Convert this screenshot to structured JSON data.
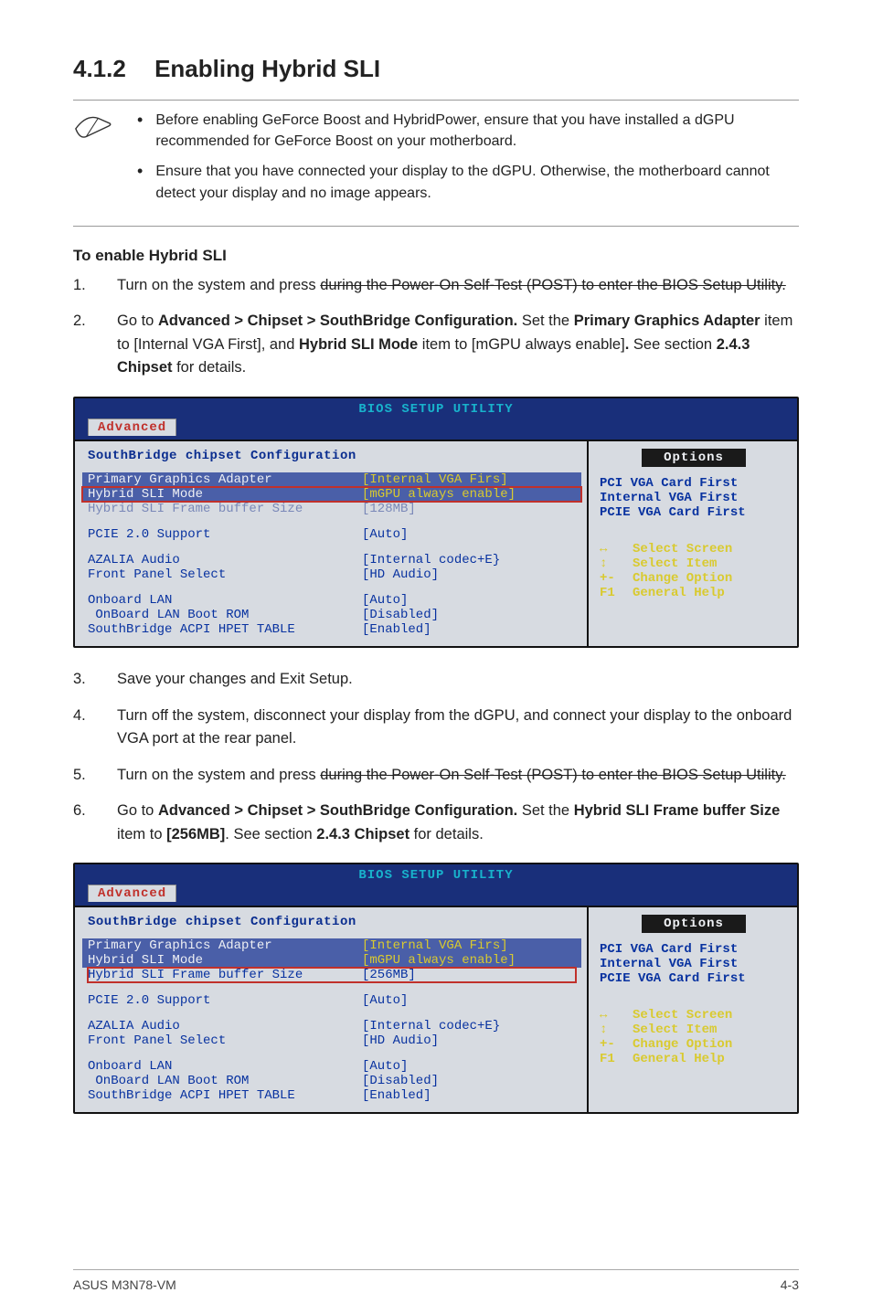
{
  "heading": {
    "number": "4.1.2",
    "title": "Enabling Hybrid SLI"
  },
  "notes": [
    "Before enabling GeForce Boost and HybridPower, ensure that you have installed a dGPU recommended for GeForce Boost on your motherboard.",
    "Ensure that you have connected your display to the dGPU. Otherwise, the motherboard cannot detect your display and no image appears."
  ],
  "enable_heading": "To enable Hybrid SLI",
  "steps_first": [
    {
      "n": "1.",
      "html": "Turn on the system and press <Del> during the Power-On Self-Test (POST) to enter the BIOS Setup Utility."
    },
    {
      "n": "2.",
      "html": "Go to <b>Advanced > Chipset > SouthBridge Configuration.</b> Set the <b>Primary Graphics Adapter</b> item to [Internal VGA First], and <b>Hybrid SLI Mode</b> item to [mGPU always enable]<b>.</b> See section <b>2.4.3 Chipset</b> for details."
    }
  ],
  "steps_second": [
    {
      "n": "3.",
      "html": "Save your changes and Exit Setup."
    },
    {
      "n": "4.",
      "html": "Turn off the system, disconnect your display from the dGPU, and connect your display to the onboard VGA port at the rear panel."
    },
    {
      "n": "5.",
      "html": "Turn on the system and press <Del> during the Power-On Self-Test (POST) to enter the BIOS Setup Utility."
    },
    {
      "n": "6.",
      "html": "Go to <b>Advanced > Chipset > SouthBridge Configuration.</b> Set the <b>Hybrid SLI Frame buffer Size</b> item to <b>[256MB]</b>. See section <b>2.4.3 Chipset</b> for details."
    }
  ],
  "bios_common": {
    "top_title": "BIOS SETUP UTILITY",
    "tab": "Advanced",
    "panel_title": "SouthBridge chipset Configuration",
    "options_title": "Options",
    "options": [
      "PCI VGA Card First",
      "Internal VGA First",
      "PCIE VGA Card First"
    ],
    "nav": [
      {
        "key": "↔",
        "txt": "Select Screen"
      },
      {
        "key": "↕",
        "txt": "Select Item"
      },
      {
        "key": "+-",
        "txt": "Change Option"
      },
      {
        "key": "F1",
        "txt": "General Help"
      }
    ]
  },
  "bios1": {
    "highlight_row_index": 1,
    "rows": [
      {
        "lbl": "Primary Graphics Adapter",
        "val": "[Internal VGA Firs]",
        "selected": true
      },
      {
        "lbl": "Hybrid SLI Mode",
        "val": "[mGPU always enable]",
        "selected": true
      },
      {
        "lbl": "Hybrid SLI Frame buffer Size",
        "val": "[128MB]",
        "dim": true
      },
      {
        "spacer": true
      },
      {
        "lbl": "PCIE 2.0 Support",
        "val": "[Auto]"
      },
      {
        "spacer": true
      },
      {
        "lbl": "AZALIA Audio",
        "val": "[Internal codec+E}"
      },
      {
        "lbl": "Front Panel Select",
        "val": "[HD Audio]"
      },
      {
        "spacer": true
      },
      {
        "lbl": "Onboard LAN",
        "val": "[Auto]"
      },
      {
        "lbl": " OnBoard LAN Boot ROM",
        "val": "[Disabled]"
      },
      {
        "lbl": "SouthBridge ACPI HPET TABLE",
        "val": "[Enabled]"
      }
    ]
  },
  "bios2": {
    "highlight_row_index": 2,
    "rows": [
      {
        "lbl": "Primary Graphics Adapter",
        "val": "[Internal VGA Firs]",
        "selected": true
      },
      {
        "lbl": "Hybrid SLI Mode",
        "val": "[mGPU always enable]",
        "selected": true
      },
      {
        "lbl": "Hybrid SLI Frame buffer Size",
        "val": "[256MB]"
      },
      {
        "spacer": true
      },
      {
        "lbl": "PCIE 2.0 Support",
        "val": "[Auto]"
      },
      {
        "spacer": true
      },
      {
        "lbl": "AZALIA Audio",
        "val": "[Internal codec+E}"
      },
      {
        "lbl": "Front Panel Select",
        "val": "[HD Audio]"
      },
      {
        "spacer": true
      },
      {
        "lbl": "Onboard LAN",
        "val": "[Auto]"
      },
      {
        "lbl": " OnBoard LAN Boot ROM",
        "val": "[Disabled]"
      },
      {
        "lbl": "SouthBridge ACPI HPET TABLE",
        "val": "[Enabled]"
      }
    ]
  },
  "footer": {
    "left": "ASUS M3N78-VM",
    "right": "4-3"
  }
}
